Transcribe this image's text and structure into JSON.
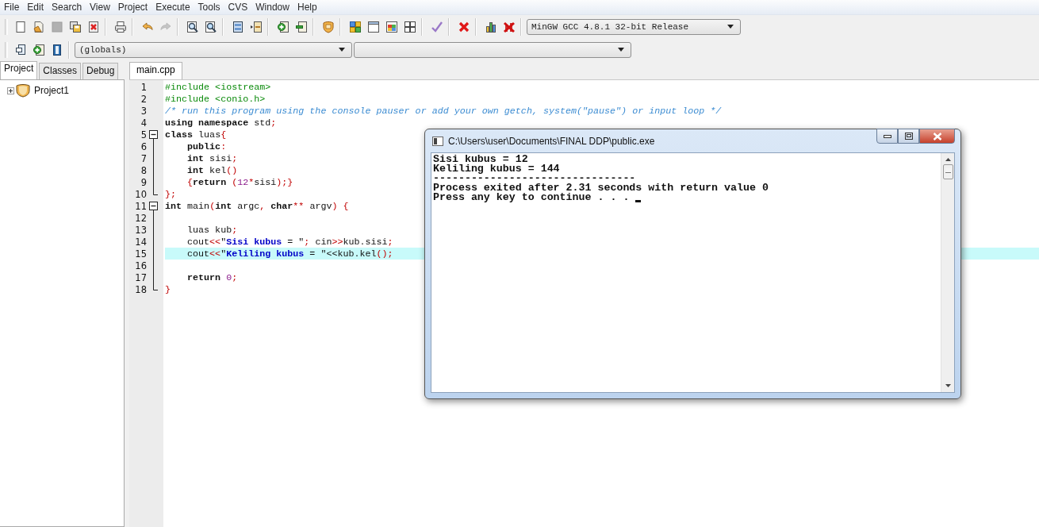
{
  "menu": [
    "File",
    "Edit",
    "Search",
    "View",
    "Project",
    "Execute",
    "Tools",
    "CVS",
    "Window",
    "Help"
  ],
  "toolbars": [
    {
      "groups": [
        [
          {
            "kind": "new",
            "disabled": false
          },
          {
            "kind": "open",
            "disabled": false
          },
          {
            "kind": "save",
            "disabled": true
          },
          {
            "kind": "save-all",
            "disabled": false
          },
          {
            "kind": "close",
            "disabled": false
          }
        ],
        [
          {
            "kind": "print",
            "disabled": false
          }
        ],
        [
          {
            "kind": "undo",
            "disabled": false
          },
          {
            "kind": "redo",
            "disabled": true
          }
        ],
        [
          {
            "kind": "find",
            "disabled": false
          },
          {
            "kind": "replace",
            "disabled": false
          }
        ],
        [
          {
            "kind": "indent",
            "disabled": false
          },
          {
            "kind": "unindent",
            "disabled": false
          }
        ],
        [
          {
            "kind": "add",
            "disabled": false
          },
          {
            "kind": "remove",
            "disabled": false
          }
        ],
        [
          {
            "kind": "options",
            "disabled": false
          }
        ],
        [
          {
            "kind": "compile",
            "disabled": false
          },
          {
            "kind": "run",
            "disabled": false
          },
          {
            "kind": "compile-run",
            "disabled": false
          },
          {
            "kind": "rebuild",
            "disabled": false
          }
        ],
        [
          {
            "kind": "check",
            "disabled": false
          }
        ],
        [
          {
            "kind": "abort",
            "disabled": false
          }
        ],
        [
          {
            "kind": "profile",
            "disabled": false
          },
          {
            "kind": "delete-profile",
            "disabled": false
          }
        ]
      ],
      "dropdowns": [
        {
          "kind": "text",
          "value": "MinGW GCC 4.8.1 32-bit Release"
        }
      ]
    },
    {
      "groups": [
        [
          {
            "kind": "insert",
            "disabled": false
          },
          {
            "kind": "add",
            "disabled": false
          },
          {
            "kind": "bookmark",
            "disabled": false
          }
        ]
      ],
      "dropdowns": [
        {
          "kind": "text",
          "value": "(globals)"
        },
        {
          "kind": "empty"
        }
      ]
    }
  ],
  "sidebar": {
    "tabs": [
      {
        "label": "Project",
        "selected": true
      },
      {
        "label": "Classes",
        "selected": false
      },
      {
        "label": "Debug",
        "selected": false
      }
    ],
    "tree": [
      {
        "label": "Project1",
        "expanded": false
      }
    ]
  },
  "editor": {
    "tabs": [
      {
        "label": "main.cpp",
        "selected": true
      }
    ],
    "lines": [
      {
        "number": "1",
        "kind": "plain",
        "highlighted": false,
        "tokens": [
          {
            "kind": "pre",
            "text": "#include <iostream>"
          }
        ]
      },
      {
        "number": "2",
        "kind": "plain",
        "highlighted": false,
        "tokens": [
          {
            "kind": "pre",
            "text": "#include <conio.h>"
          }
        ]
      },
      {
        "number": "3",
        "kind": "plain",
        "highlighted": false,
        "tokens": [
          {
            "kind": "comment",
            "text": "/* run this program using the console pauser or add your own getch, system(\"pause\") or input loop */"
          }
        ]
      },
      {
        "number": "4",
        "kind": "plain",
        "highlighted": false,
        "tokens": [
          {
            "kind": "keyword",
            "text": "using namespace"
          },
          {
            "kind": "plain",
            "text": " std"
          },
          {
            "kind": "symbol",
            "text": ";"
          }
        ]
      },
      {
        "number": "5",
        "kind": "fold-start",
        "highlighted": false,
        "tokens": [
          {
            "kind": "keyword",
            "text": "class"
          },
          {
            "kind": "plain",
            "text": " luas"
          },
          {
            "kind": "symbol",
            "text": "{"
          }
        ]
      },
      {
        "number": "6",
        "kind": "fold-line",
        "highlighted": false,
        "tokens": [
          {
            "kind": "keyword",
            "text": "    public"
          },
          {
            "kind": "symbol",
            "text": ":"
          }
        ]
      },
      {
        "number": "7",
        "kind": "fold-line",
        "highlighted": false,
        "tokens": [
          {
            "kind": "keyword",
            "text": "    int"
          },
          {
            "kind": "plain",
            "text": " sisi"
          },
          {
            "kind": "symbol",
            "text": ";"
          }
        ]
      },
      {
        "number": "8",
        "kind": "fold-line",
        "highlighted": false,
        "tokens": [
          {
            "kind": "keyword",
            "text": "    int"
          },
          {
            "kind": "plain",
            "text": " kel"
          },
          {
            "kind": "symbol",
            "text": "()"
          }
        ]
      },
      {
        "number": "9",
        "kind": "fold-line",
        "highlighted": false,
        "tokens": [
          {
            "kind": "symbol",
            "text": "    {"
          },
          {
            "kind": "keyword",
            "text": "return"
          },
          {
            "kind": "symbol",
            "text": " ("
          },
          {
            "kind": "number",
            "text": "12"
          },
          {
            "kind": "symbol",
            "text": "*"
          },
          {
            "kind": "plain",
            "text": "sisi"
          },
          {
            "kind": "symbol",
            "text": ");}"
          }
        ]
      },
      {
        "number": "10",
        "kind": "fold-end",
        "highlighted": false,
        "tokens": [
          {
            "kind": "symbol",
            "text": "};"
          }
        ]
      },
      {
        "number": "11",
        "kind": "fold-start",
        "highlighted": false,
        "tokens": [
          {
            "kind": "keyword",
            "text": "int"
          },
          {
            "kind": "plain",
            "text": " main"
          },
          {
            "kind": "symbol",
            "text": "("
          },
          {
            "kind": "keyword",
            "text": "int"
          },
          {
            "kind": "plain",
            "text": " argc"
          },
          {
            "kind": "symbol",
            "text": ", "
          },
          {
            "kind": "keyword",
            "text": "char"
          },
          {
            "kind": "symbol",
            "text": "**"
          },
          {
            "kind": "plain",
            "text": " argv"
          },
          {
            "kind": "symbol",
            "text": ") {"
          }
        ]
      },
      {
        "number": "12",
        "kind": "fold-line",
        "highlighted": false
      },
      {
        "number": "13",
        "kind": "fold-line",
        "highlighted": false,
        "tokens": [
          {
            "kind": "plain",
            "text": "    luas kub"
          },
          {
            "kind": "symbol",
            "text": ";"
          }
        ]
      },
      {
        "number": "14",
        "kind": "fold-line",
        "highlighted": false,
        "tokens": [
          {
            "kind": "plain",
            "text": "    cout"
          },
          {
            "kind": "symbol",
            "text": "<<"
          },
          {
            "kind": "plain",
            "text": "\""
          },
          {
            "kind": "string",
            "text": "Sisi kubus"
          },
          {
            "kind": "plain",
            "text": " = \""
          },
          {
            "kind": "symbol",
            "text": ";"
          },
          {
            "kind": "plain",
            "text": " cin"
          },
          {
            "kind": "symbol",
            "text": ">>"
          },
          {
            "kind": "plain",
            "text": "kub.sisi"
          },
          {
            "kind": "symbol",
            "text": ";"
          }
        ]
      },
      {
        "number": "15",
        "kind": "fold-line",
        "highlighted": true,
        "tokens": [
          {
            "kind": "plain",
            "text": "    cout"
          },
          {
            "kind": "symbol",
            "text": "<<"
          },
          {
            "kind": "plain",
            "text": "\""
          },
          {
            "kind": "string",
            "text": "Keliling kubus"
          },
          {
            "kind": "plain",
            "text": " = \"<<kub.kel"
          },
          {
            "kind": "symbol",
            "text": "();"
          }
        ]
      },
      {
        "number": "16",
        "kind": "fold-line",
        "highlighted": false
      },
      {
        "number": "17",
        "kind": "fold-line",
        "highlighted": false,
        "tokens": [
          {
            "kind": "keyword",
            "text": "    return "
          },
          {
            "kind": "number",
            "text": "0"
          },
          {
            "kind": "symbol",
            "text": ";"
          }
        ]
      },
      {
        "number": "18",
        "kind": "fold-end",
        "highlighted": false,
        "tokens": [
          {
            "kind": "symbol",
            "text": "}"
          }
        ]
      }
    ]
  },
  "console": {
    "title": "C:\\Users\\user\\Documents\\FINAL DDP\\public.exe",
    "lines": [
      "Sisi kubus = 12",
      "Keliling kubus = 144",
      "--------------------------------",
      "Process exited after 2.31 seconds with return value 0",
      "Press any key to continue . . . "
    ]
  }
}
